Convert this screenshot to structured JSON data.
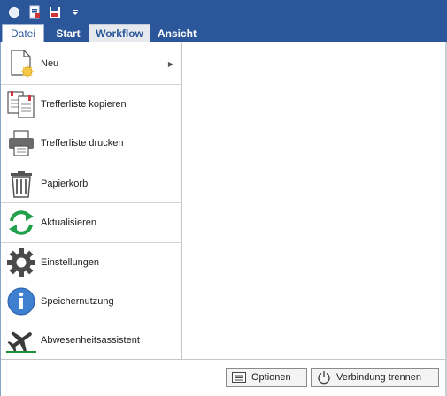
{
  "ribbon": {
    "tabs": [
      {
        "label": "Datei"
      },
      {
        "label": "Start"
      },
      {
        "label": "Workflow"
      },
      {
        "label": "Ansicht"
      }
    ]
  },
  "quick_access": {
    "icons": [
      "app-orb-icon",
      "new-document-icon",
      "save-icon",
      "customize-dropdown-icon"
    ]
  },
  "menu": {
    "items": [
      {
        "label": "Neu",
        "icon": "new-document-icon",
        "has_submenu": true
      },
      {
        "label": "Trefferliste kopieren",
        "icon": "copy-icon"
      },
      {
        "label": "Trefferliste drucken",
        "icon": "printer-icon"
      },
      {
        "label": "Papierkorb",
        "icon": "trash-icon"
      },
      {
        "label": "Aktualisieren",
        "icon": "refresh-icon"
      },
      {
        "label": "Einstellungen",
        "icon": "gear-icon"
      },
      {
        "label": "Speichernutzung",
        "icon": "info-icon"
      },
      {
        "label": "Abwesenheitsassistent",
        "icon": "airplane-icon"
      }
    ]
  },
  "footer": {
    "options_label": "Optionen",
    "disconnect_label": "Verbindung trennen"
  },
  "colors": {
    "ribbon_blue": "#2b579a",
    "refresh_green": "#21a14a",
    "info_blue": "#3f7fcf",
    "active_green": "#1e8c3a"
  }
}
